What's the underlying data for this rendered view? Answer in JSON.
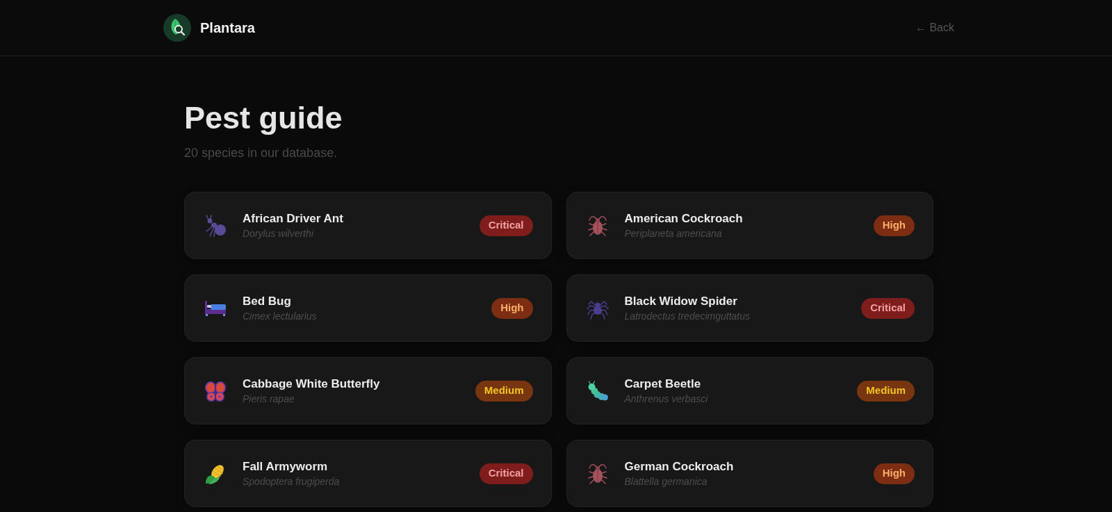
{
  "header": {
    "logo_text": "Plantara",
    "back_link": "← Back"
  },
  "page": {
    "title": "Pest guide",
    "subtitle": "20 species in our database."
  },
  "pests": [
    {
      "name": "African Driver Ant",
      "scientific_name": "Dorylus wilverthi",
      "kind": "ant",
      "severity": {
        "label": "Critical",
        "color": "#7f1d1d"
      }
    },
    {
      "name": "American Cockroach",
      "scientific_name": "Periplaneta americana",
      "kind": "cockroach",
      "severity": {
        "label": "High",
        "color": "#7c2d12"
      }
    },
    {
      "name": "Bed Bug",
      "scientific_name": "Cimex lectularius",
      "kind": "bed",
      "severity": {
        "label": "High",
        "color": "#7c2d12"
      }
    },
    {
      "name": "Black Widow Spider",
      "scientific_name": "Latrodectus tredecimguttatus",
      "kind": "spider",
      "severity": {
        "label": "Critical",
        "color": "#7f1d1d"
      }
    },
    {
      "name": "Cabbage White Butterfly",
      "scientific_name": "Pieris rapae",
      "kind": "butterfly",
      "severity": {
        "label": "Medium",
        "color": "#78350f"
      }
    },
    {
      "name": "Carpet Beetle",
      "scientific_name": "Anthrenus verbasci",
      "kind": "caterpillar",
      "severity": {
        "label": "Medium",
        "color": "#78350f"
      }
    },
    {
      "name": "Fall Armyworm",
      "scientific_name": "Spodoptera frugiperda",
      "kind": "corn",
      "severity": {
        "label": "Critical",
        "color": "#7f1d1d"
      }
    },
    {
      "name": "German Cockroach",
      "scientific_name": "Blattella germanica",
      "kind": "cockroach",
      "severity": {
        "label": "High",
        "color": "#7c2d12"
      }
    }
  ]
}
